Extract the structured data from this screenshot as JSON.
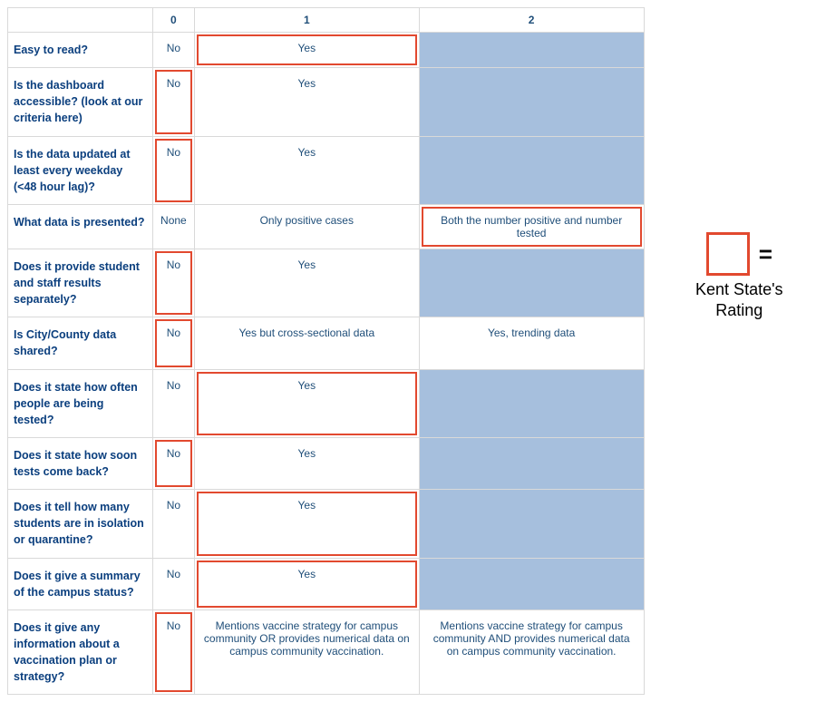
{
  "legend": {
    "equals": "=",
    "label": "Kent State's Rating"
  },
  "columns": {
    "c0": "0",
    "c1": "1",
    "c2": "2"
  },
  "rows": [
    {
      "criterion": "Easy to read?",
      "c0": {
        "text": "No",
        "grey": false,
        "highlight": false
      },
      "c1": {
        "text": "Yes",
        "grey": false,
        "highlight": true
      },
      "c2": {
        "text": "",
        "grey": true,
        "highlight": false
      }
    },
    {
      "criterion": "Is the dashboard accessible? (look at our criteria here)",
      "c0": {
        "text": "No",
        "grey": false,
        "highlight": true
      },
      "c1": {
        "text": "Yes",
        "grey": false,
        "highlight": false
      },
      "c2": {
        "text": "",
        "grey": true,
        "highlight": false
      }
    },
    {
      "criterion": "Is the data updated at least every weekday (<48 hour lag)?",
      "c0": {
        "text": "No",
        "grey": false,
        "highlight": true
      },
      "c1": {
        "text": "Yes",
        "grey": false,
        "highlight": false
      },
      "c2": {
        "text": "",
        "grey": true,
        "highlight": false
      }
    },
    {
      "criterion": "What data is presented?",
      "c0": {
        "text": "None",
        "grey": false,
        "highlight": false
      },
      "c1": {
        "text": "Only positive cases",
        "grey": false,
        "highlight": false
      },
      "c2": {
        "text": "Both the number positive and number tested",
        "grey": false,
        "highlight": true
      }
    },
    {
      "criterion": "Does it provide student and staff results separately?",
      "c0": {
        "text": "No",
        "grey": false,
        "highlight": true
      },
      "c1": {
        "text": "Yes",
        "grey": false,
        "highlight": false
      },
      "c2": {
        "text": "",
        "grey": true,
        "highlight": false
      }
    },
    {
      "criterion": "Is City/County data shared?",
      "c0": {
        "text": "No",
        "grey": false,
        "highlight": true
      },
      "c1": {
        "text": "Yes but cross-sectional data",
        "grey": false,
        "highlight": false
      },
      "c2": {
        "text": "Yes, trending data",
        "grey": false,
        "highlight": false
      }
    },
    {
      "criterion": "Does it state how often people are being tested?",
      "c0": {
        "text": "No",
        "grey": false,
        "highlight": false
      },
      "c1": {
        "text": "Yes",
        "grey": false,
        "highlight": true
      },
      "c2": {
        "text": "",
        "grey": true,
        "highlight": false
      }
    },
    {
      "criterion": "Does it state how soon tests come back?",
      "c0": {
        "text": "No",
        "grey": false,
        "highlight": true
      },
      "c1": {
        "text": "Yes",
        "grey": false,
        "highlight": false
      },
      "c2": {
        "text": "",
        "grey": true,
        "highlight": false
      }
    },
    {
      "criterion": "Does it tell how many students are in isolation or quarantine?",
      "c0": {
        "text": "No",
        "grey": false,
        "highlight": false
      },
      "c1": {
        "text": "Yes",
        "grey": false,
        "highlight": true
      },
      "c2": {
        "text": "",
        "grey": true,
        "highlight": false
      }
    },
    {
      "criterion": "Does it give a summary of the campus status?",
      "c0": {
        "text": "No",
        "grey": false,
        "highlight": false
      },
      "c1": {
        "text": "Yes",
        "grey": false,
        "highlight": true
      },
      "c2": {
        "text": "",
        "grey": true,
        "highlight": false
      }
    },
    {
      "criterion": "Does it give any information about a vaccination plan or strategy?",
      "c0": {
        "text": "No",
        "grey": false,
        "highlight": true
      },
      "c1": {
        "text": "Mentions vaccine strategy for campus community OR provides numerical data on campus community vaccination.",
        "grey": false,
        "highlight": false
      },
      "c2": {
        "text": "Mentions vaccine strategy for campus community AND provides numerical data on campus community vaccination.",
        "grey": false,
        "highlight": false
      }
    }
  ]
}
